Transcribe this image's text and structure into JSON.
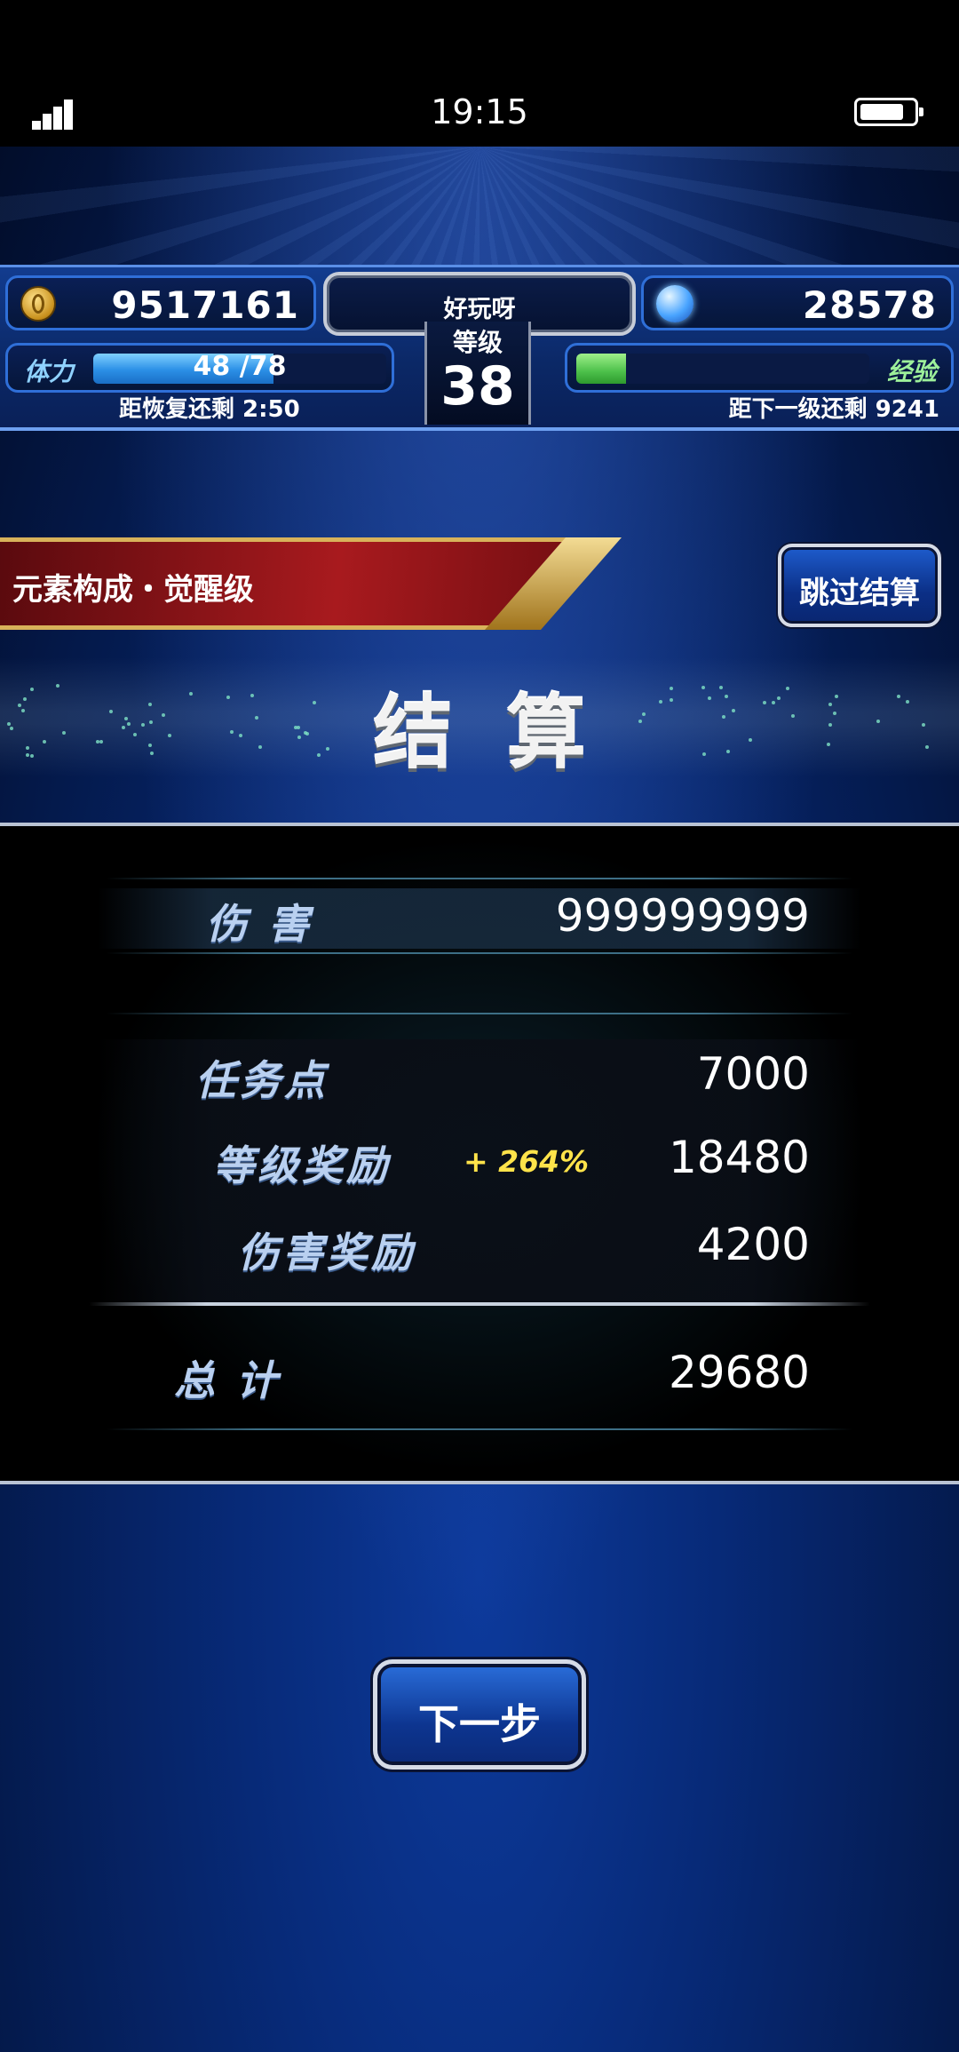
{
  "status_bar": {
    "time": "19:15"
  },
  "hud": {
    "gil": "9517161",
    "gems": "28578",
    "player_name": "好玩呀",
    "level_label": "等级",
    "level": "38",
    "stamina_label": "体力",
    "stamina_value": "48 /78",
    "stamina_fraction": 0.615,
    "stamina_recover_text": "距恢复还剩 2:50",
    "exp_label": "经验",
    "exp_fraction": 0.17,
    "exp_next_text": "距下一级还剩 9241"
  },
  "quest": {
    "name": "元素构成・觉醒级"
  },
  "skip_button": {
    "label": "跳过结算"
  },
  "title": "结算",
  "results": {
    "damage_label": "伤 害",
    "damage_value": "999999999",
    "mission_points_label": "任务点",
    "mission_points_value": "7000",
    "level_bonus_label": "等级奖励",
    "level_bonus_percent": "+ 264%",
    "level_bonus_value": "18480",
    "damage_bonus_label": "伤害奖励",
    "damage_bonus_value": "4200",
    "total_label": "总 计",
    "total_value": "29680"
  },
  "next_button": {
    "label": "下一步"
  },
  "colors": {
    "accent_blue": "#0b2f86",
    "banner_red": "#a81a1e",
    "bonus_yellow": "#ffe34a"
  }
}
